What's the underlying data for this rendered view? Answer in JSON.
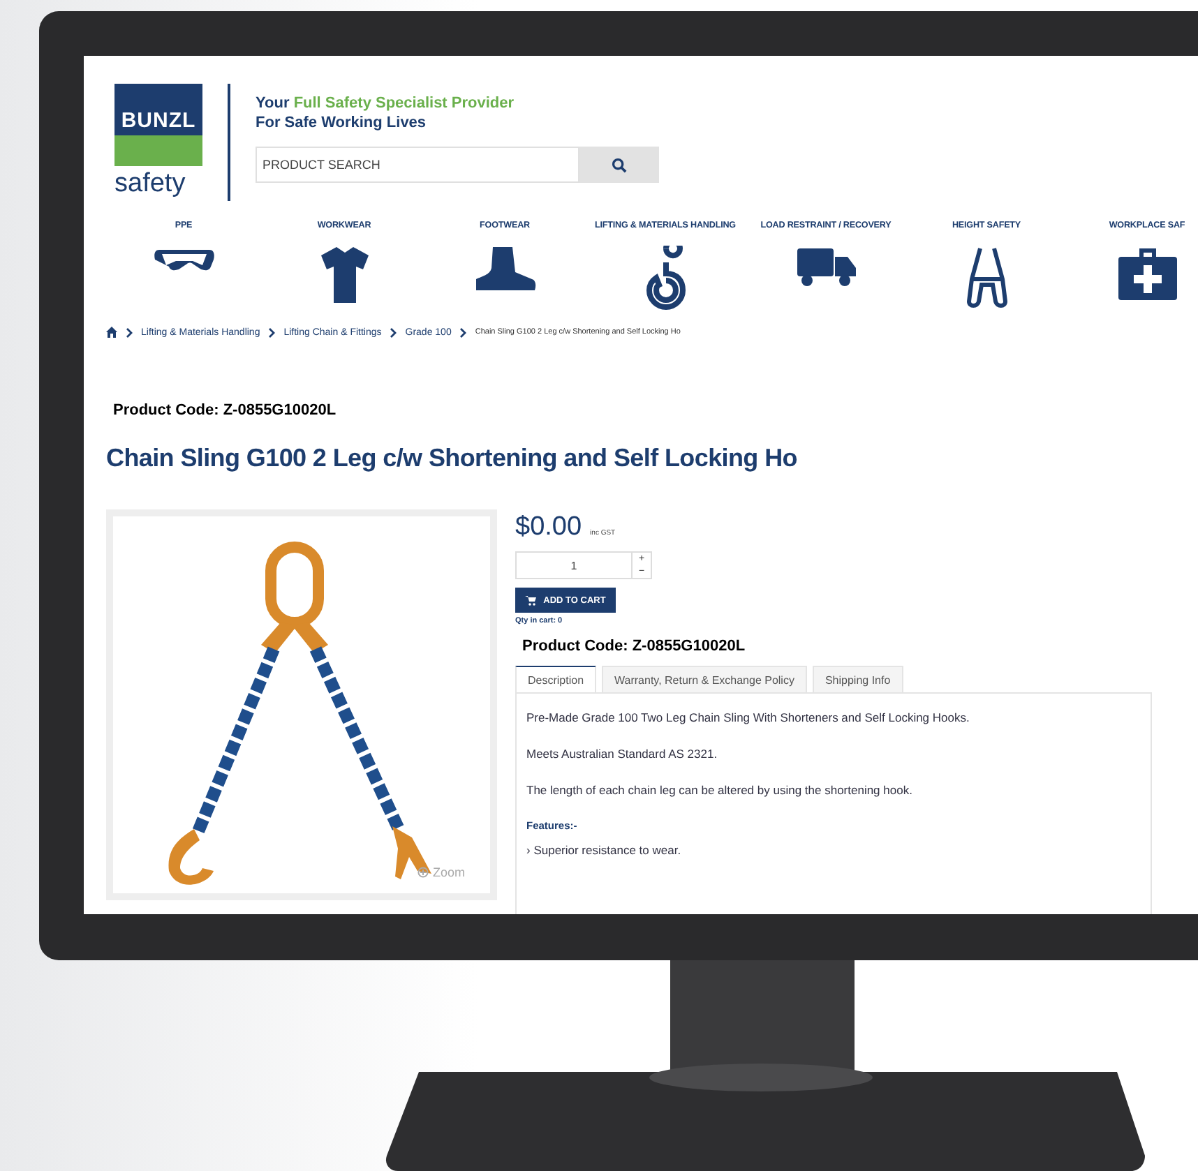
{
  "header": {
    "logo_top": "BUNZL",
    "logo_bottom": "safety",
    "tagline_lead": "Your",
    "tagline_highlight": "Full Safety Specialist Provider",
    "tagline_line2": "For Safe Working Lives",
    "search": {
      "placeholder": "PRODUCT SEARCH"
    }
  },
  "categories": [
    {
      "label": "PPE",
      "kind": "goggles"
    },
    {
      "label": "WORKWEAR",
      "kind": "shirt"
    },
    {
      "label": "FOOTWEAR",
      "kind": "boot"
    },
    {
      "label": "LIFTING & MATERIALS HANDLING",
      "kind": "hook"
    },
    {
      "label": "LOAD RESTRAINT / RECOVERY",
      "kind": "truck"
    },
    {
      "label": "HEIGHT SAFETY",
      "kind": "harness"
    },
    {
      "label": "WORKPLACE SAF",
      "kind": "firstaid"
    }
  ],
  "breadcrumbs": [
    "Lifting & Materials Handling",
    "Lifting Chain & Fittings",
    "Grade 100",
    "Chain Sling G100 2 Leg c/w Shortening and Self Locking Ho"
  ],
  "product": {
    "code": "Product Code: Z-0855G10020L",
    "title": "Chain Sling G100 2 Leg c/w Shortening and Self Locking Ho",
    "image": {
      "kind": "picture",
      "zoom": "Zoom"
    },
    "price": "$0.00",
    "price_note": "inc GST",
    "quantity": "1",
    "step_up": "+",
    "step_down": "−",
    "add_to_cart": "ADD TO CART",
    "qty_in_cart": "Qty in cart: 0",
    "code_repeat": "Product Code: Z-0855G10020L",
    "tabs": [
      {
        "label": "Description",
        "selected": true
      },
      {
        "label": "Warranty, Return & Exchange Policy",
        "selected": false
      },
      {
        "label": "Shipping Info",
        "selected": false
      }
    ],
    "description": [
      "Pre-Made Grade 100 Two Leg Chain Sling With Shorteners and Self Locking Hooks.",
      "Meets Australian Standard AS 2321.",
      "The length of each chain leg can be altered by using the shortening hook."
    ],
    "features_heading": "Features:-",
    "features": [
      "› Superior resistance to wear."
    ]
  }
}
